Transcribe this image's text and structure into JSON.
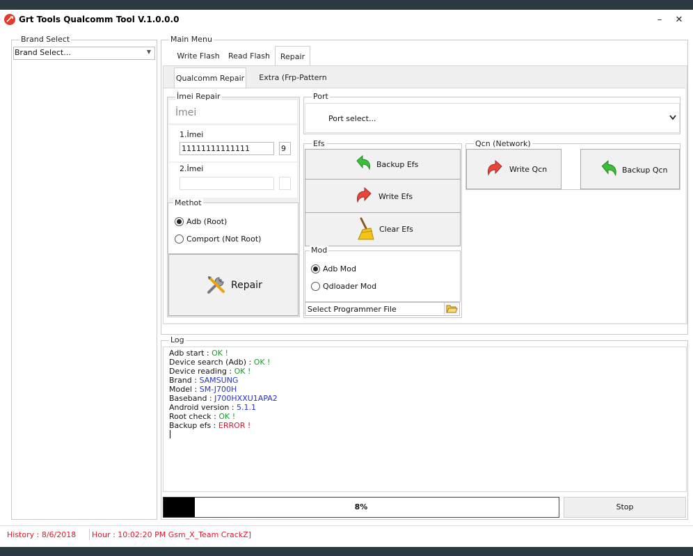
{
  "window": {
    "title": "Grt Tools Qualcomm Tool V.1.0.0.0",
    "minimize": "–",
    "close": "✕"
  },
  "brand": {
    "group_label": "Brand Select",
    "select_value": "Brand Select..."
  },
  "main_menu": {
    "label": "Main Menu",
    "tabs": [
      "Write Flash",
      "Read Flash",
      "Repair"
    ],
    "active_tab": "Repair",
    "subtabs": [
      "Qualcomm Repair",
      "Extra (Frp-Pattern Lock)"
    ]
  },
  "imei_repair": {
    "label": "İmei Repair",
    "heading": "İmei",
    "imei1_label": "1.İmei",
    "imei1_value": "11111111111111",
    "imei1_check": "9",
    "imei2_label": "2.İmei",
    "imei2_value": "",
    "imei2_check": ""
  },
  "method": {
    "label": "Methot",
    "options": [
      "Adb (Root)",
      "Comport (Not Root)"
    ],
    "selected": "Adb (Root)"
  },
  "repair_button": "Repair",
  "port": {
    "label": "Port",
    "value": "Port select..."
  },
  "efs": {
    "label": "Efs",
    "backup": "Backup Efs",
    "write": "Write Efs",
    "clear": "Clear Efs"
  },
  "qcn": {
    "label": "Qcn (Network)",
    "write": "Write Qcn",
    "backup": "Backup Qcn"
  },
  "mod": {
    "label": "Mod",
    "options": [
      "Adb Mod",
      "Qdloader Mod"
    ],
    "selected": "Adb Mod",
    "programmer": "Select Programmer File"
  },
  "log": {
    "label": "Log",
    "lines": [
      {
        "key": "Adb start : ",
        "value": "OK !",
        "color": "#1a9a2a"
      },
      {
        "key": "Device search (Adb) : ",
        "value": "OK !",
        "color": "#1a9a2a"
      },
      {
        "key": "Device reading : ",
        "value": "OK !",
        "color": "#1a9a2a"
      },
      {
        "key": "Brand : ",
        "value": "SAMSUNG",
        "color": "#2233cc"
      },
      {
        "key": "Model : ",
        "value": "SM-J700H",
        "color": "#2233cc"
      },
      {
        "key": "Baseband : ",
        "value": "J700HXXU1APA2",
        "color": "#2233cc"
      },
      {
        "key": "Android version : ",
        "value": "5.1.1",
        "color": "#2233cc"
      },
      {
        "key": "Root check : ",
        "value": "OK !",
        "color": "#1a9a2a"
      },
      {
        "key": "Backup efs : ",
        "value": "ERROR !",
        "color": "#e0162b"
      }
    ]
  },
  "progress": {
    "percent": 8,
    "label": "8%"
  },
  "stop_button": "Stop",
  "status": {
    "history": "History : 8/6/2018",
    "hour": "Hour  : 10:02:20 PM Gsm_X_Team CrackZ]"
  }
}
